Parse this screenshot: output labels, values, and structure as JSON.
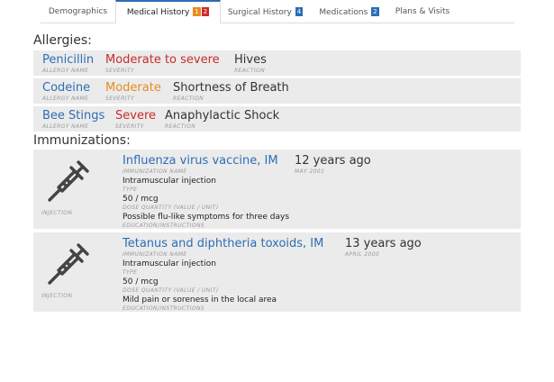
{
  "tabs": [
    {
      "label": "Demographics",
      "badges": []
    },
    {
      "label": "Medical History",
      "badges": [
        {
          "text": "1",
          "color": "#e98b1f"
        },
        {
          "text": "2",
          "color": "#c92b2b"
        }
      ]
    },
    {
      "label": "Surgical History",
      "badges": [
        {
          "text": "4",
          "color": "#2d6db5"
        }
      ]
    },
    {
      "label": "Medications",
      "badges": [
        {
          "text": "2",
          "color": "#2d6db5"
        }
      ]
    },
    {
      "label": "Plans & Visits",
      "badges": []
    }
  ],
  "active_tab": "Medical History",
  "allergies": {
    "heading": "Allergies:",
    "labels": {
      "name": "ALLERGY NAME",
      "severity": "SEVERITY",
      "reaction": "REACTION"
    },
    "items": [
      {
        "name": "Penicillin",
        "severity": "Moderate to severe",
        "severity_color": "#c92b2b",
        "reaction": "Hives"
      },
      {
        "name": "Codeine",
        "severity": "Moderate",
        "severity_color": "#e98b1f",
        "reaction": "Shortness of Breath"
      },
      {
        "name": "Bee Stings",
        "severity": "Severe",
        "severity_color": "#c92b2b",
        "reaction": "Anaphylactic Shock"
      }
    ]
  },
  "immunizations": {
    "heading": "Immunizations:",
    "labels": {
      "name": "IMMUNIZATION NAME",
      "type": "TYPE",
      "dose": "DOSE QUANTITY (VALUE / UNIT)",
      "education": "EDUCATION/INSTRUCTIONS",
      "icon_caption": "INJECTION"
    },
    "items": [
      {
        "name": "Influenza virus vaccine, IM",
        "ago": "12 years ago",
        "date": "MAY 2001",
        "type": "Intramuscular injection",
        "dose": "50 / mcg",
        "education": "Possible flu-like symptoms for three days",
        "icon": "syringe-icon"
      },
      {
        "name": "Tetanus and diphtheria toxoids, IM",
        "ago": "13 years ago",
        "date": "APRIL 2000",
        "type": "Intramuscular injection",
        "dose": "50 / mcg",
        "education": "Mild pain or soreness in the local area",
        "icon": "syringe-icon"
      }
    ]
  },
  "colors": {
    "accent": "#2d6db5",
    "row_bg": "#ebebeb",
    "caption": "#9a9a9a"
  }
}
